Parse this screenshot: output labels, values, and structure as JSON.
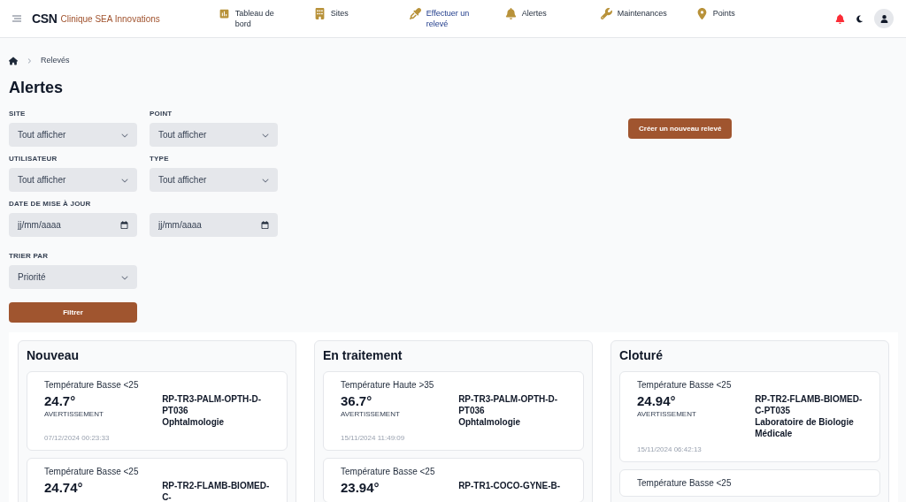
{
  "header": {
    "logo": "CSN",
    "company": "Clinique SEA Innovations",
    "nav": [
      {
        "kind": "dashboard",
        "label": "Tableau de bord",
        "selected": false
      },
      {
        "kind": "sites",
        "label": "Sites",
        "selected": false
      },
      {
        "kind": "reading",
        "label": "Effectuer un relevé",
        "selected": true
      },
      {
        "kind": "alerts",
        "label": "Alertes",
        "selected": false
      },
      {
        "kind": "maintenance",
        "label": "Maintenances",
        "selected": false
      },
      {
        "kind": "points",
        "label": "Points",
        "selected": false
      }
    ],
    "notifications": {
      "unread": true
    }
  },
  "breadcrumb": [
    "Relevés"
  ],
  "title": "Alertes",
  "create_button": "Créer un nouveau relevé",
  "filters": [
    {
      "kind": "select",
      "label": "SITE",
      "value": "Tout afficher"
    },
    {
      "kind": "select",
      "label": "POINT",
      "value": "Tout afficher"
    },
    {
      "kind": "select",
      "label": "UTILISATEUR",
      "value": "Tout afficher"
    },
    {
      "kind": "select",
      "label": "TYPE",
      "value": "Tout afficher"
    },
    {
      "kind": "date",
      "label": "DATE DE MISE À JOUR",
      "placeholder": "jj/mm/aaaa"
    },
    {
      "kind": "date",
      "placeholder": "jj/mm/aaaa"
    },
    {
      "kind": "select",
      "label": "TRIER PAR",
      "value": "Priorité"
    }
  ],
  "filter_button": "Filtrer",
  "columns": [
    {
      "title": "Nouveau",
      "cards": [
        {
          "type": "Température Basse <25",
          "value": "24.7°",
          "severity": "AVERTISSEMENT",
          "point": "RP-TR3-PALM-OPTH-D-PT036",
          "location": "Ophtalmologie",
          "date": "07/12/2024 00:23:33"
        },
        {
          "type": "Température Basse <25",
          "value": "24.74°",
          "point": "RP-TR2-FLAMB-BIOMED-C-"
        }
      ]
    },
    {
      "title": "En traitement",
      "cards": [
        {
          "type": "Température Haute >35",
          "value": "36.7°",
          "severity": "AVERTISSEMENT",
          "point": "RP-TR3-PALM-OPTH-D-PT036",
          "location": "Ophtalmologie",
          "date": "15/11/2024 11:49:09"
        },
        {
          "type": "Température Basse <25",
          "value": "23.94°",
          "point": "RP-TR1-COCO-GYNE-B-"
        }
      ]
    },
    {
      "title": "Cloturé",
      "cards": [
        {
          "type": "Température Basse <25",
          "value": "24.94°",
          "severity": "AVERTISSEMENT",
          "point": "RP-TR2-FLAMB-BIOMED-C-PT035",
          "location": "Laboratoire de Biologie Médicale",
          "date": "15/11/2024 06:42:13"
        },
        {
          "type": "Température Basse <25"
        }
      ]
    }
  ]
}
